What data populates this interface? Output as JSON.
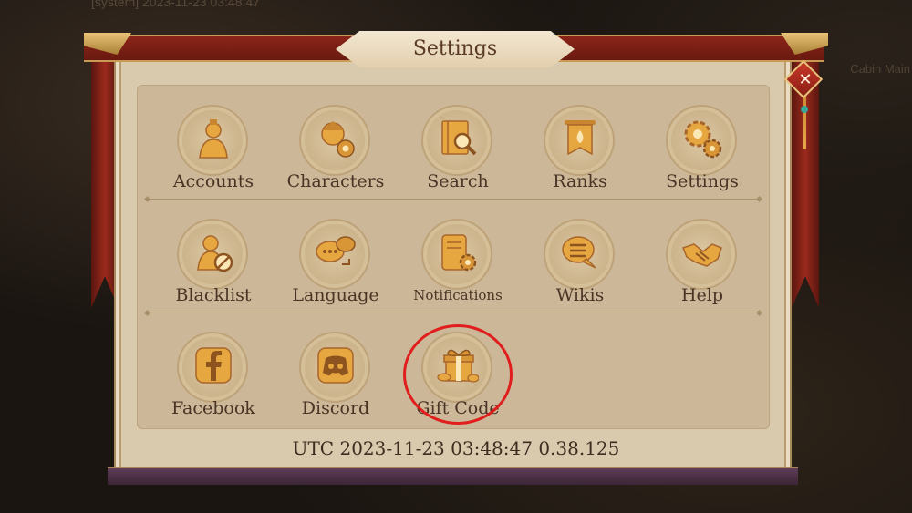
{
  "background": {
    "blurred_text_top": "[system] 2023-11-23 03:48:47",
    "blurred_text_right": "Cabin Main"
  },
  "dialog": {
    "title": "Settings",
    "close_icon": "close-icon",
    "rows": [
      [
        {
          "name": "accounts",
          "label": "Accounts",
          "icon": "person-icon"
        },
        {
          "name": "characters",
          "label": "Characters",
          "icon": "character-gear-icon"
        },
        {
          "name": "search",
          "label": "Search",
          "icon": "book-magnifier-icon"
        },
        {
          "name": "ranks",
          "label": "Ranks",
          "icon": "banner-icon"
        },
        {
          "name": "settings",
          "label": "Settings",
          "icon": "gears-icon"
        }
      ],
      [
        {
          "name": "blacklist",
          "label": "Blacklist",
          "icon": "person-blocked-icon"
        },
        {
          "name": "language",
          "label": "Language",
          "icon": "speech-bubbles-icon"
        },
        {
          "name": "notifications",
          "label": "Notifications",
          "icon": "scroll-gear-icon"
        },
        {
          "name": "wikis",
          "label": "Wikis",
          "icon": "chat-bubble-icon"
        },
        {
          "name": "help",
          "label": "Help",
          "icon": "handshake-icon"
        }
      ],
      [
        {
          "name": "facebook",
          "label": "Facebook",
          "icon": "facebook-icon"
        },
        {
          "name": "discord",
          "label": "Discord",
          "icon": "discord-icon"
        },
        {
          "name": "gift-code",
          "label": "Gift Code",
          "icon": "gift-icon"
        }
      ]
    ],
    "footer": "UTC 2023-11-23 03:48:47 0.38.125"
  },
  "colors": {
    "panel": "#d9c9ad",
    "icon_gold": "#e3a73f",
    "highlight_circle": "#e01e1e",
    "text_dark": "#4a3426"
  }
}
